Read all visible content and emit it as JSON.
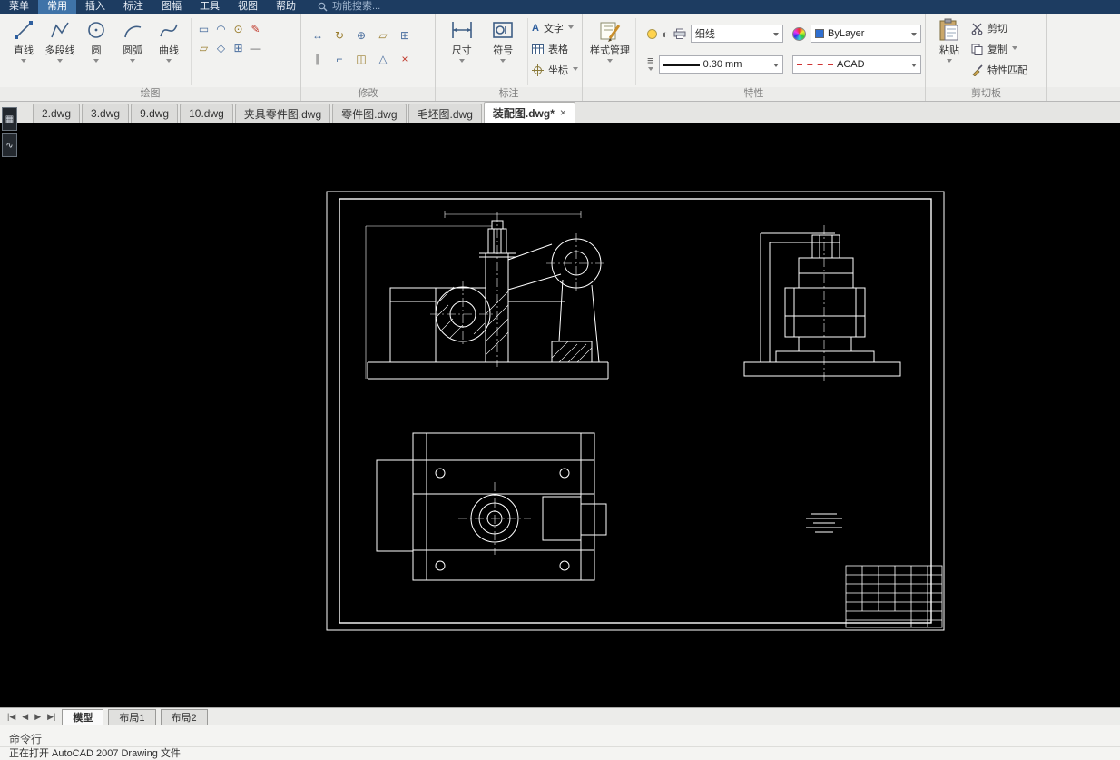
{
  "menubar": {
    "menu": "菜单",
    "tabs": [
      {
        "label": "常用"
      },
      {
        "label": "插入"
      },
      {
        "label": "标注"
      },
      {
        "label": "图幅"
      },
      {
        "label": "工具"
      },
      {
        "label": "视图"
      },
      {
        "label": "帮助"
      }
    ],
    "search": "功能搜索..."
  },
  "icons": {
    "hamburger": "≡",
    "contrast": "◐",
    "text_glyph": "A",
    "draw_small": [
      "▭",
      "◠",
      "⊙",
      "✎",
      "▱",
      "◇",
      "⊞",
      "—"
    ],
    "modify_small": [
      "↔",
      "↻",
      "⊕",
      "▱",
      "⊞",
      "∥",
      "⌐",
      "◫",
      "△",
      "×"
    ],
    "side": [
      "▦",
      "∿"
    ],
    "nav": [
      "|◀",
      "◀",
      "▶",
      "▶|"
    ]
  },
  "ribbon": {
    "draw": {
      "label": "绘图",
      "tools": [
        {
          "label": "直线"
        },
        {
          "label": "多段线"
        },
        {
          "label": "圆"
        },
        {
          "label": "圆弧"
        },
        {
          "label": "曲线"
        }
      ]
    },
    "modify": {
      "label": "修改"
    },
    "annotate": {
      "label": "标注",
      "dim": "尺寸",
      "symbol": "符号",
      "text": "文字",
      "table": "表格",
      "coord": "坐标"
    },
    "props": {
      "label": "特性",
      "style_mgr": "样式管理",
      "display_mode": "细线",
      "layer": "ByLayer",
      "lineweight": "0.30 mm",
      "linetype": "ACAD"
    },
    "clipboard": {
      "label": "剪切板",
      "paste": "粘贴",
      "cut": "剪切",
      "copy": "复制",
      "match": "特性匹配"
    }
  },
  "doctabs": [
    {
      "label": "2.dwg"
    },
    {
      "label": "3.dwg"
    },
    {
      "label": "9.dwg"
    },
    {
      "label": "10.dwg"
    },
    {
      "label": "夹具零件图.dwg"
    },
    {
      "label": "零件图.dwg"
    },
    {
      "label": "毛坯图.dwg"
    },
    {
      "label": "装配图.dwg*"
    }
  ],
  "ui": {
    "close_glyph": "×"
  },
  "layoutbar": {
    "tabs": [
      {
        "label": "模型"
      },
      {
        "label": "布局1"
      },
      {
        "label": "布局2"
      }
    ]
  },
  "command": {
    "title": "命令行",
    "status": "正在打开 AutoCAD 2007 Drawing 文件"
  }
}
